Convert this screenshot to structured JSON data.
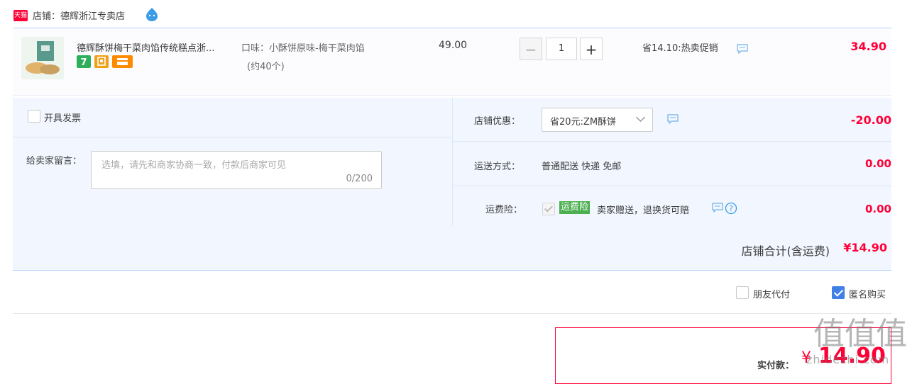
{
  "shop": {
    "badge_text": "天猫",
    "name_label": "店铺：德辉浙江专卖店"
  },
  "item": {
    "title": "德辉酥饼梅干菜肉馅传统糕点浙...",
    "sku_line1": "口味：小酥饼原味-梅干菜肉馅",
    "sku_line2": "(约40个)",
    "badge_icons": [
      "seven-day-return-icon",
      "shop-guarantee-icon",
      "credit-card-icon"
    ],
    "price": "49.00",
    "quantity": "1",
    "promo": "省14.10:热卖促销",
    "subtotal": "34.90"
  },
  "options": {
    "invoice_label": "开具发票",
    "memo_label": "给卖家留言：",
    "memo_placeholder": "选填，请先和商家协商一致，付款后商家可见",
    "memo_count": "0/200",
    "shop_discount_label": "店铺优惠：",
    "shop_discount_selected": "省20元:ZM酥饼",
    "shop_discount_amount": "-20.00",
    "shipping_label": "运送方式：",
    "shipping_value": "普通配送 快递 免邮",
    "shipping_amount": "0.00",
    "insurance_label": "运费险：",
    "insurance_tag": "运费险",
    "insurance_desc": "卖家赠送，退换货可赔",
    "insurance_amount": "0.00"
  },
  "summary": {
    "shop_total_label": "店铺合计(含运费)",
    "shop_total_value": "¥14.90",
    "friend_pay_label": "朋友代付",
    "anonymous_label": "匿名购买",
    "anonymous_checked": true,
    "friend_pay_checked": false,
    "pay_label": "实付款：",
    "pay_currency": "¥",
    "pay_value": "14.90"
  },
  "watermark": {
    "mark": "值值值",
    "url": "zhidezhi.com"
  },
  "colors": {
    "accent_red": "#ff0036",
    "border_blue": "#b2d1ff",
    "panel_blue": "#f2f7ff",
    "check_blue": "#3f7fe6",
    "insurance_green": "#4caf50"
  }
}
